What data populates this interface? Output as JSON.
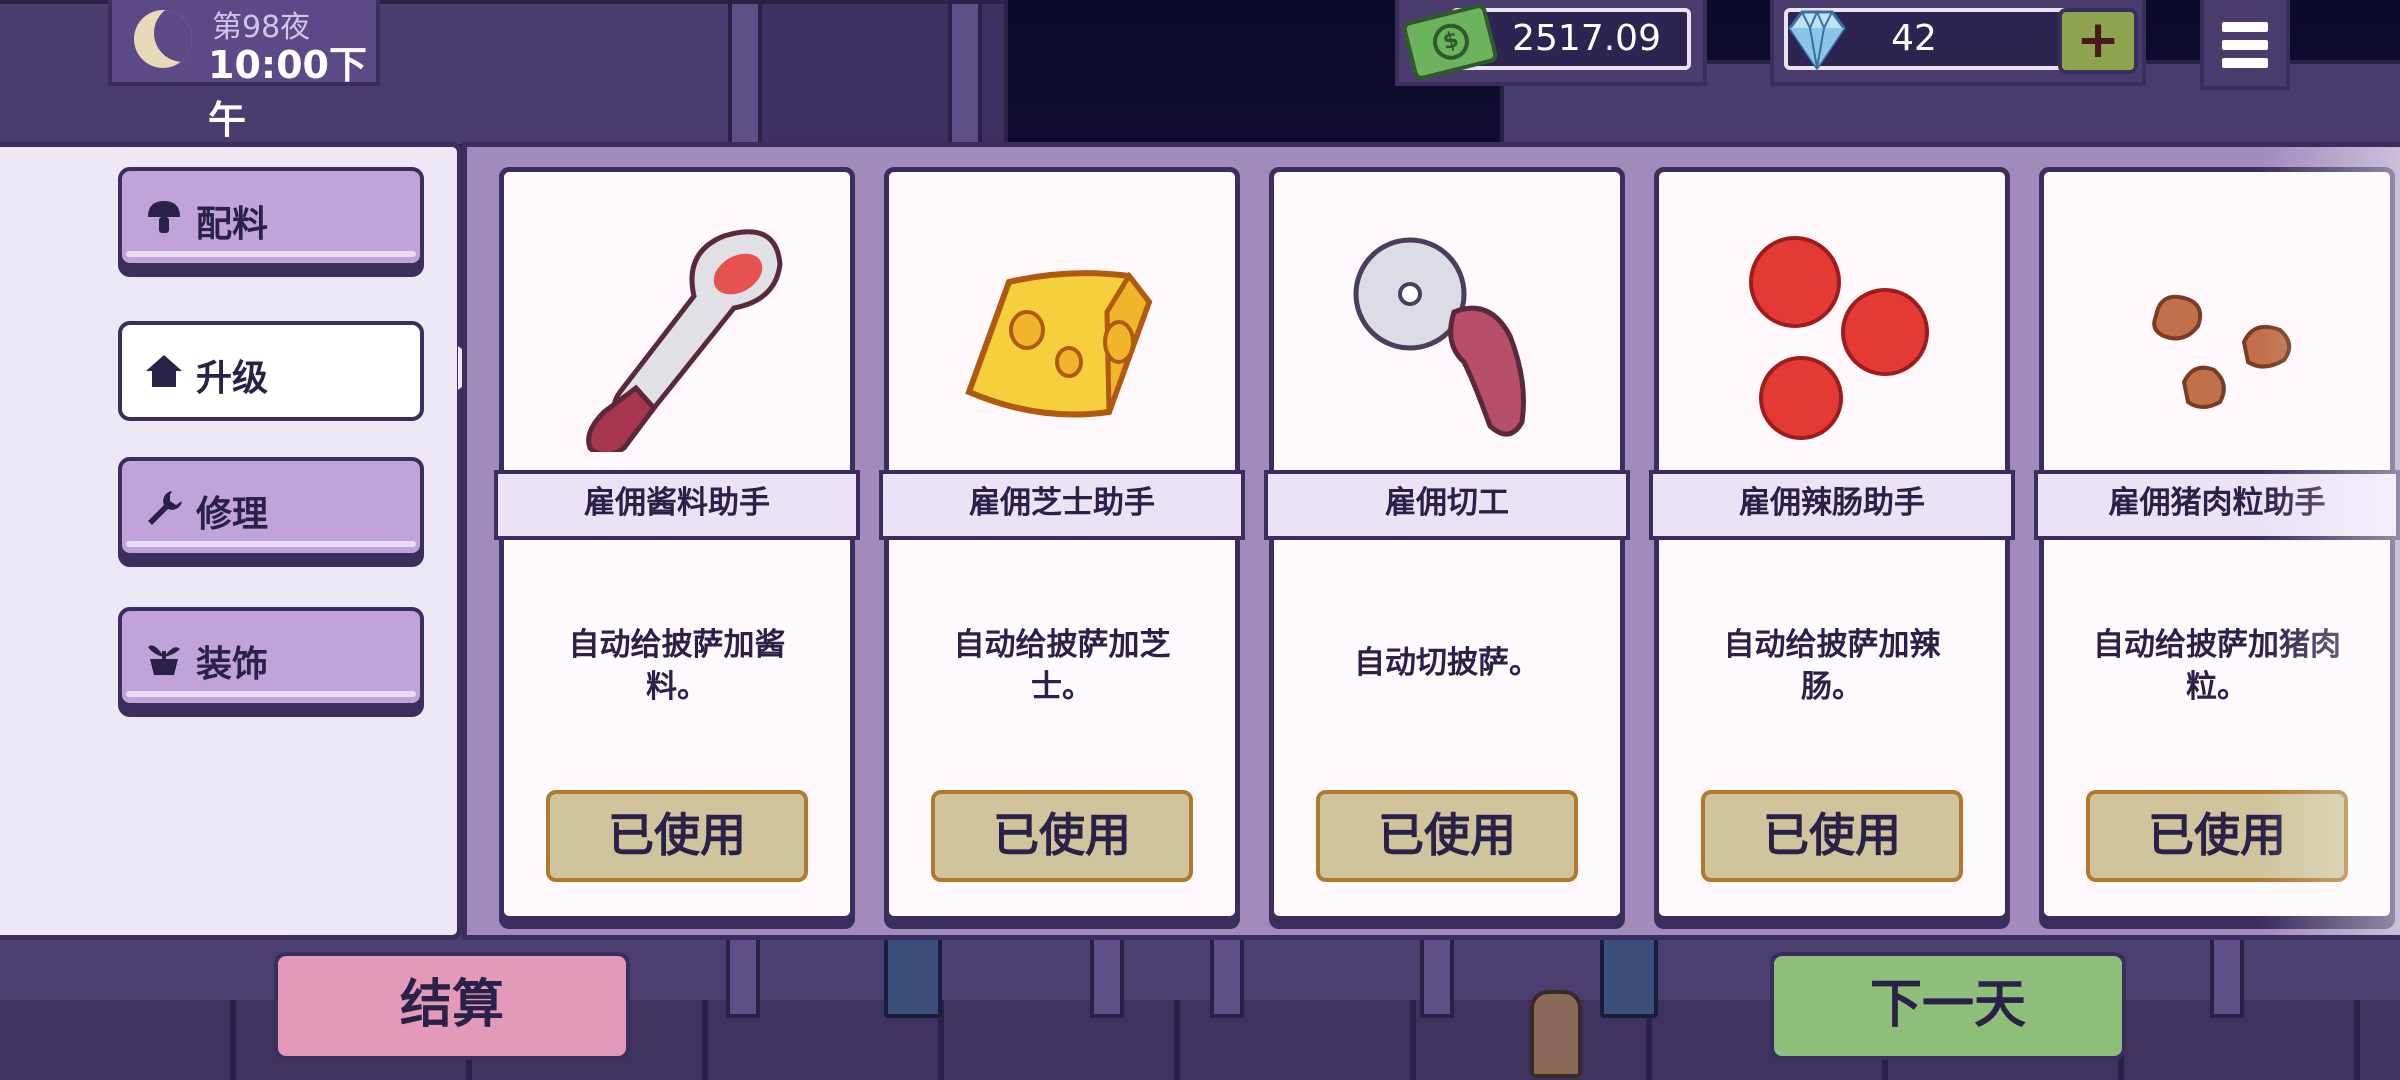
{
  "hud": {
    "night": "第98夜",
    "time": "10:00下午",
    "money": "2517.09",
    "gems": "42",
    "plus": "+"
  },
  "menu": [
    {
      "label": "配料",
      "icon": "mushroom-icon",
      "active": false
    },
    {
      "label": "升级",
      "icon": "house-icon",
      "active": true
    },
    {
      "label": "修理",
      "icon": "wrench-icon",
      "active": false
    },
    {
      "label": "装饰",
      "icon": "plant-icon",
      "active": false
    }
  ],
  "cards": [
    {
      "title": "雇佣酱料助手",
      "desc": "自动给披萨加酱料。",
      "button": "已使用",
      "icon": "sauce-spoon-icon"
    },
    {
      "title": "雇佣芝士助手",
      "desc": "自动给披萨加芝士。",
      "button": "已使用",
      "icon": "cheese-icon"
    },
    {
      "title": "雇佣切工",
      "desc": "自动切披萨。",
      "button": "已使用",
      "icon": "pizza-cutter-icon"
    },
    {
      "title": "雇佣辣肠助手",
      "desc": "自动给披萨加辣肠。",
      "button": "已使用",
      "icon": "pepperoni-icon"
    },
    {
      "title": "雇佣猪肉粒助手",
      "desc": "自动给披萨加猪肉粒。",
      "button": "已使用",
      "icon": "pork-bits-icon"
    }
  ],
  "bottom": {
    "settle": "结算",
    "next_day": "下一天"
  },
  "colors": {
    "panel": "#a08bbd",
    "tab": "#c0a3d8",
    "used_button": "#cfc49c",
    "settle_button": "#e39ab8",
    "next_button": "#8fbe7a"
  }
}
